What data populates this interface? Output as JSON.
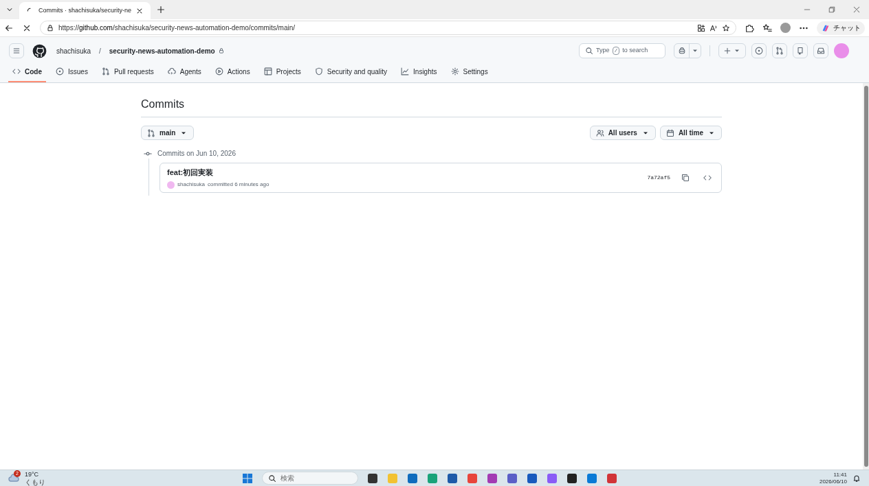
{
  "browser": {
    "tab_title": "Commits · shachisuka/security-ne",
    "url_prefix": "https://",
    "url_host": "github.com",
    "url_path": "/shachisuka/security-news-automation-demo/commits/main/",
    "copilot_label": "チャット"
  },
  "header": {
    "owner": "shachisuka",
    "separator": "/",
    "repo": "security-news-automation-demo",
    "search": {
      "before": "Type",
      "key": "/",
      "after": "to search"
    }
  },
  "nav": [
    {
      "label": "Code",
      "selected": true
    },
    {
      "label": "Issues",
      "selected": false
    },
    {
      "label": "Pull requests",
      "selected": false
    },
    {
      "label": "Agents",
      "selected": false
    },
    {
      "label": "Actions",
      "selected": false
    },
    {
      "label": "Projects",
      "selected": false
    },
    {
      "label": "Security and quality",
      "selected": false
    },
    {
      "label": "Insights",
      "selected": false
    },
    {
      "label": "Settings",
      "selected": false
    }
  ],
  "page": {
    "title": "Commits",
    "branch": "main",
    "filters": [
      {
        "label": "All users"
      },
      {
        "label": "All time"
      }
    ],
    "groups": [
      {
        "heading": "Commits on Jun 10, 2026",
        "commits": [
          {
            "message": "feat:初回実装",
            "author": "shachisuka",
            "meta": "committed 6 minutes ago",
            "sha": "7a72af5"
          }
        ]
      }
    ]
  },
  "taskbar": {
    "weather": {
      "badge": "2",
      "temp": "19°C",
      "condition": "くもり"
    },
    "search_placeholder": "検索",
    "time": "11:41",
    "date": "2026/06/10"
  }
}
